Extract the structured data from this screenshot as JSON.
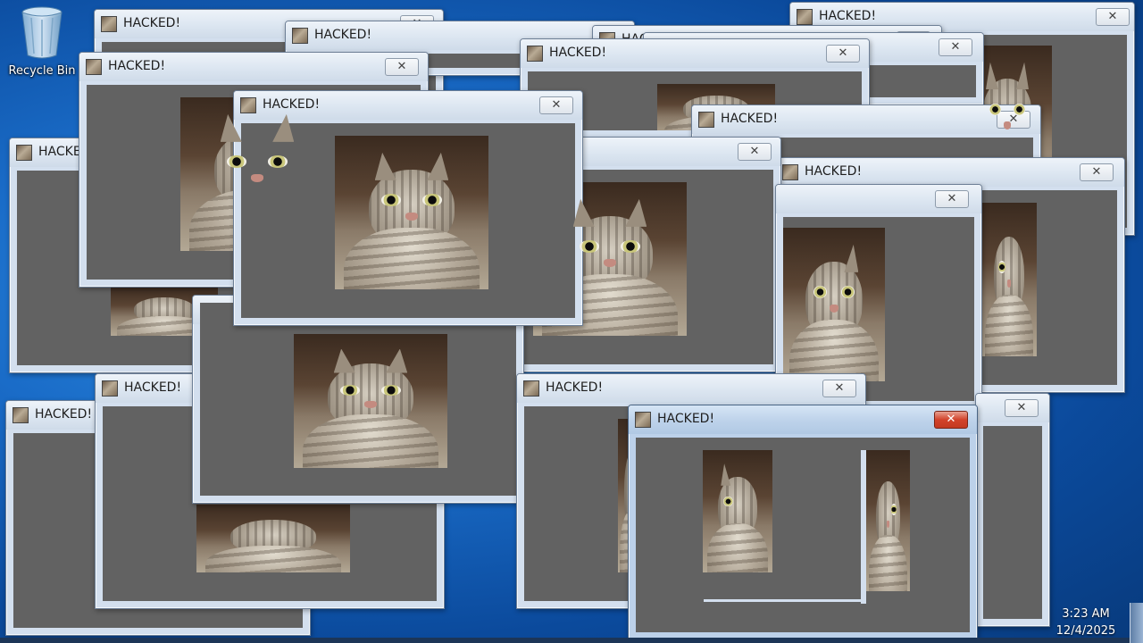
{
  "desktop": {
    "icons": [
      {
        "label": "Recycle Bin",
        "icon": "recycle-bin-icon"
      }
    ]
  },
  "popup": {
    "title": "HACKED!",
    "close_glyph": "✕",
    "image_icon": "cat-photo-icon"
  },
  "taskbar": {
    "clock": {
      "time": "3:23 AM",
      "date": "12/4/2025"
    }
  },
  "colors": {
    "desktop_blue": "#1a6cc8",
    "window_frame": "#d3dfee",
    "content_gray": "#626262",
    "close_red": "#d2432b"
  }
}
